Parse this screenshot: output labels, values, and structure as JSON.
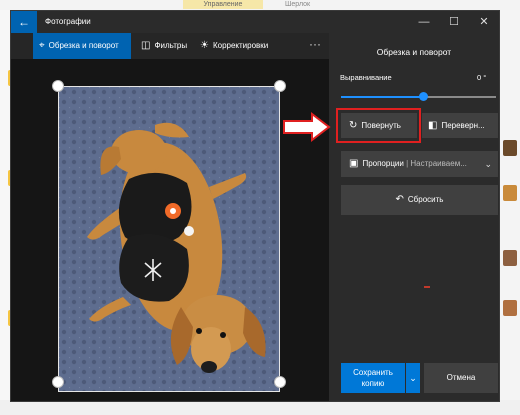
{
  "background": {
    "tab_label": "Управление",
    "tab2_label": "Шерлок"
  },
  "window": {
    "title": "Фотографии",
    "back_icon": "back-arrow-icon",
    "controls": {
      "minimize": "—",
      "maximize": "☐",
      "close": "✕"
    }
  },
  "toolbar": {
    "items": [
      {
        "label": "Обрезка и поворот",
        "icon": "crop-icon",
        "active": true
      },
      {
        "label": "Фильтры",
        "icon": "filter-icon",
        "active": false
      },
      {
        "label": "Корректировки",
        "icon": "sun-icon",
        "active": false
      }
    ],
    "more": "···"
  },
  "panel": {
    "title": "Обрезка и поворот",
    "alignment_label": "Выравнивание",
    "alignment_value": "0 °",
    "alignment_fraction": 0.55,
    "rotate_label": "Повернуть",
    "flip_label": "Переверн...",
    "aspect_label": "Пропорции",
    "aspect_value": "Настраиваем...",
    "reset_label": "Сбросить",
    "save_label_line1": "Сохранить",
    "save_label_line2": "копию",
    "cancel_label": "Отмена"
  },
  "colors": {
    "accent": "#0063b1",
    "highlight_box": "#e02020"
  }
}
